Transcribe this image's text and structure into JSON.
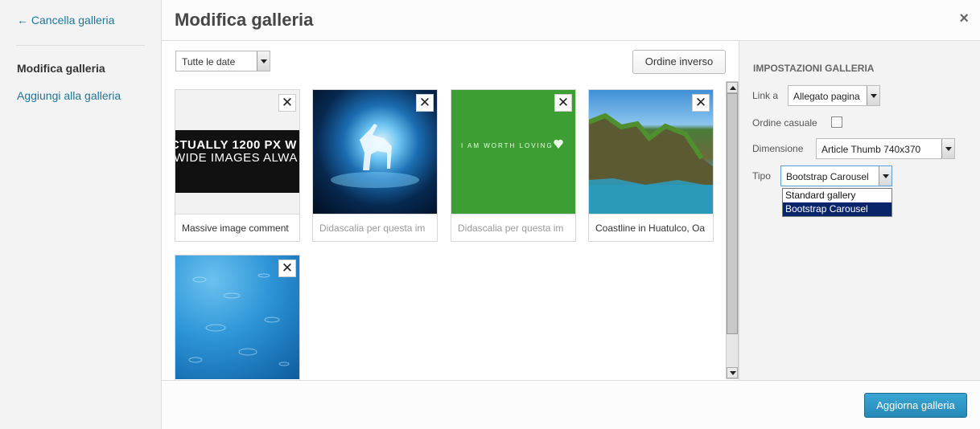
{
  "menu": {
    "cancel_label": "← Cancella galleria",
    "active_item": "Modifica galleria",
    "add_item": "Aggiungi alla galleria"
  },
  "header": {
    "title": "Modifica galleria",
    "close_icon": "×"
  },
  "toolbar": {
    "date_filter": "Tutte le date",
    "reverse_label": "Ordine inverso"
  },
  "attachments": [
    {
      "caption": "Massive image comment",
      "is_placeholder": false,
      "thumb_text_1": "CTUALLY 1200 PX W",
      "thumb_text_2": "WIDE IMAGES ALWA"
    },
    {
      "caption": "Didascalia per questa im",
      "is_placeholder": true
    },
    {
      "caption": "Didascalia per questa im",
      "is_placeholder": true,
      "thumb_text": "I AM WORTH LOVING"
    },
    {
      "caption": "Coastline in Huatulco, Oa",
      "is_placeholder": false
    },
    {
      "caption": "",
      "is_placeholder": false
    }
  ],
  "settings": {
    "heading": "IMPOSTAZIONI GALLERIA",
    "link_label": "Link a",
    "link_value": "Allegato pagina",
    "random_label": "Ordine casuale",
    "random_checked": false,
    "size_label": "Dimensione",
    "size_value": "Article Thumb 740x370",
    "type_label": "Tipo",
    "type_value": "Bootstrap Carousel",
    "type_options": [
      "Standard gallery",
      "Bootstrap Carousel"
    ]
  },
  "footer": {
    "update_label": "Aggiorna galleria"
  },
  "remove_icon": "✕",
  "colors": {
    "link": "#21759b",
    "primary_button": "#2ea2cc",
    "selected_option": "#0a246a"
  }
}
